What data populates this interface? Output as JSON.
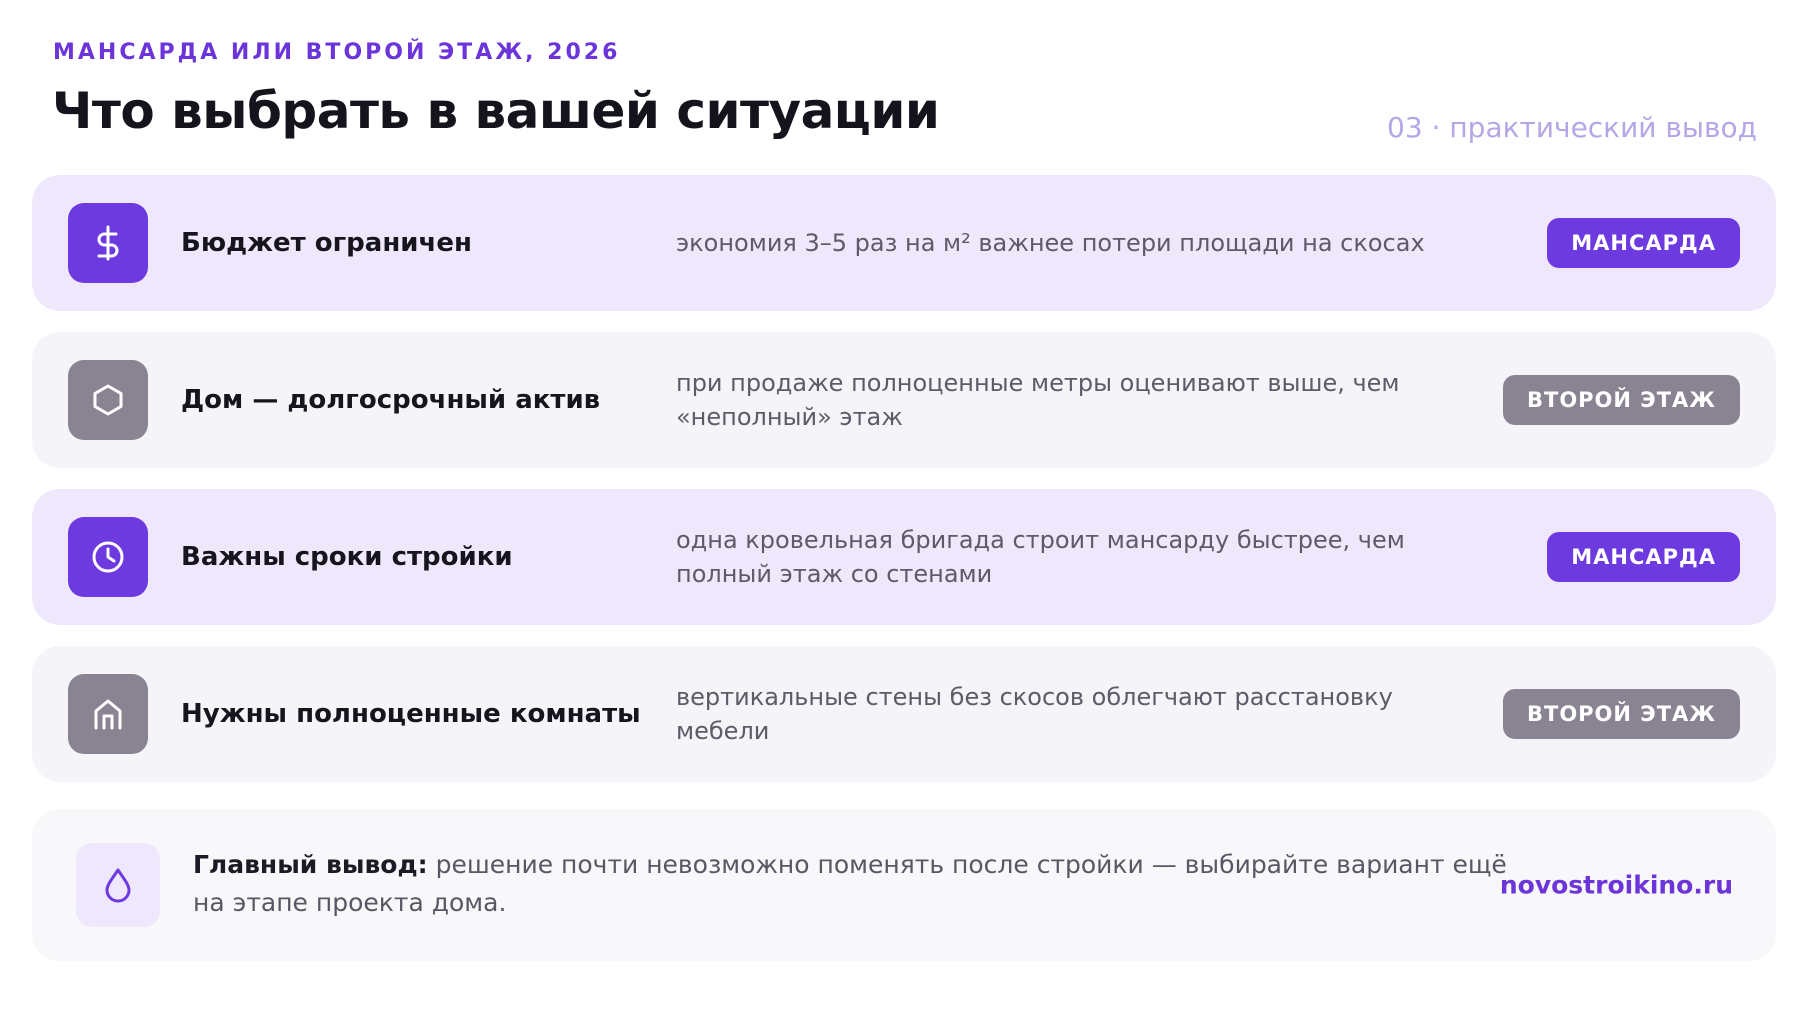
{
  "header": {
    "eyebrow": "МАНСАРДА ИЛИ ВТОРОЙ ЭТАЖ, 2026",
    "title": "Что выбрать в вашей ситуации",
    "section_tag": "03 · практический вывод"
  },
  "rows": [
    {
      "icon": "dollar-icon",
      "title": "Бюджет ограничен",
      "description": "экономия 3–5 раз на м² важнее потери площади на скосах",
      "badge": "МАНСАРДА",
      "accent": "#6d3ae0"
    },
    {
      "icon": "hexagon-icon",
      "title": "Дом — долгосрочный актив",
      "description": "при продаже полноценные метры оценивают выше, чем «неполный» этаж",
      "badge": "ВТОРОЙ ЭТАЖ",
      "accent": "#8a8492"
    },
    {
      "icon": "clock-icon",
      "title": "Важны сроки стройки",
      "description": "одна кровельная бригада строит мансарду быстрее, чем полный этаж со стенами",
      "badge": "МАНСАРДА",
      "accent": "#6d3ae0"
    },
    {
      "icon": "house-icon",
      "title": "Нужны полноценные комнаты",
      "description": "вертикальные стены без скосов облегчают расстановку мебели",
      "badge": "ВТОРОЙ ЭТАЖ",
      "accent": "#8a8492"
    }
  ],
  "summary": {
    "icon": "droplet-icon",
    "lead": "Главный вывод:",
    "text": " решение почти невозможно поменять после стройки — выбирайте вариант ещё на этапе проекта дома.",
    "site": "novostroikino.ru"
  }
}
